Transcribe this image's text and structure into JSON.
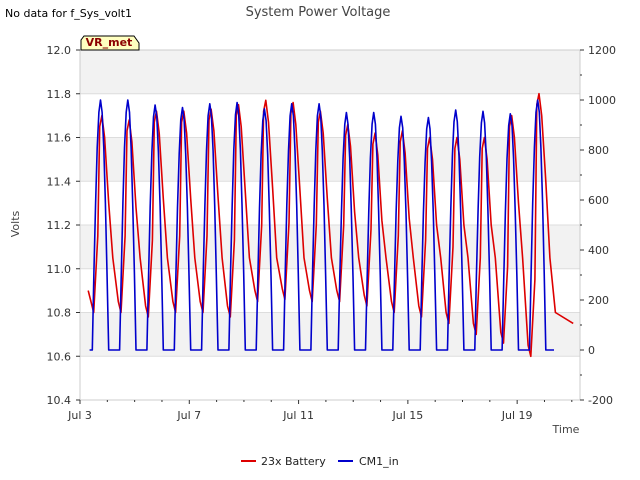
{
  "header": {
    "no_data_text": "No data for f_Sys_volt1"
  },
  "chart_data": {
    "type": "line",
    "title": "System Power Voltage",
    "xlabel": "Time",
    "ylabel": "Volts",
    "y_left_lim": [
      10.4,
      12.0
    ],
    "y_right_lim": [
      -200,
      1200
    ],
    "x_range_days": [
      3.0,
      21.3
    ],
    "x_ticks": [
      {
        "label": "Jul 3",
        "day": 3
      },
      {
        "label": "Jul 7",
        "day": 7
      },
      {
        "label": "Jul 11",
        "day": 11
      },
      {
        "label": "Jul 15",
        "day": 15
      },
      {
        "label": "Jul 19",
        "day": 19
      }
    ],
    "y_left_ticks": [
      "10.4",
      "10.6",
      "10.8",
      "11.0",
      "11.2",
      "11.4",
      "11.6",
      "11.8",
      "12.0"
    ],
    "y_right_ticks": [
      "-200",
      "0",
      "200",
      "400",
      "600",
      "800",
      "1000",
      "1200"
    ],
    "grid": true,
    "annotation_badge": "VR_met",
    "legend_position": "bottom-center",
    "series": [
      {
        "name": "23x Battery",
        "color": "#dd0000",
        "axis": "left",
        "daily_peaks": [
          11.7,
          11.68,
          11.72,
          11.72,
          11.73,
          11.75,
          11.77,
          11.76,
          11.72,
          11.66,
          11.62,
          11.63,
          11.6,
          11.6,
          11.6,
          11.7,
          11.8
        ],
        "daily_troughs": [
          10.8,
          10.8,
          10.78,
          10.8,
          10.8,
          10.78,
          10.85,
          10.86,
          10.85,
          10.85,
          10.83,
          10.8,
          10.78,
          10.75,
          10.7,
          10.66,
          10.6
        ],
        "start_value": 10.9,
        "end_value": 10.75
      },
      {
        "name": "CM1_in",
        "color": "#0000cc",
        "axis": "right",
        "daily_peaks": [
          1000,
          1000,
          980,
          970,
          985,
          990,
          965,
          985,
          985,
          950,
          950,
          935,
          930,
          960,
          955,
          945,
          1000
        ],
        "baseline": 0
      }
    ]
  }
}
